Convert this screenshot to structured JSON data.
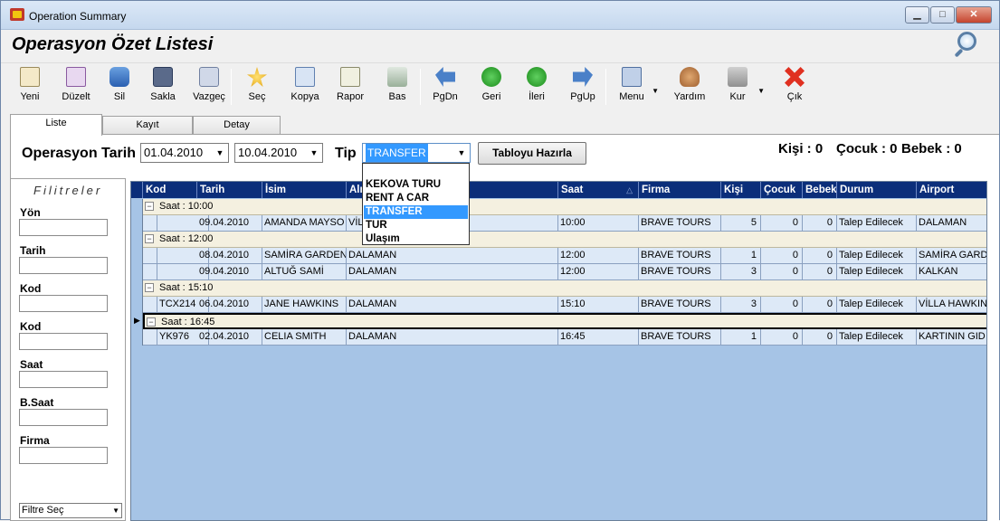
{
  "window": {
    "title": "Operation Summary",
    "minimize": "▁",
    "maximize": "□",
    "close": "✕"
  },
  "header": {
    "title": "Operasyon Özet Listesi"
  },
  "toolbar": [
    {
      "label": "Yeni",
      "icon": "new-document-icon"
    },
    {
      "label": "Düzelt",
      "icon": "edit-icon"
    },
    {
      "label": "Sil",
      "icon": "delete-database-icon"
    },
    {
      "label": "Sakla",
      "icon": "save-icon"
    },
    {
      "label": "Vazgeç",
      "icon": "cancel-icon"
    },
    {
      "label": "Seç",
      "icon": "select-star-icon"
    },
    {
      "label": "Kopya",
      "icon": "copy-icon"
    },
    {
      "label": "Rapor",
      "icon": "report-icon"
    },
    {
      "label": "Bas",
      "icon": "print-icon"
    },
    {
      "label": "PgDn",
      "icon": "page-down-icon"
    },
    {
      "label": "Geri",
      "icon": "back-icon"
    },
    {
      "label": "İleri",
      "icon": "forward-icon"
    },
    {
      "label": "PgUp",
      "icon": "page-up-icon"
    },
    {
      "label": "Menu",
      "icon": "menu-icon"
    },
    {
      "label": "Yardım",
      "icon": "help-icon"
    },
    {
      "label": "Kur",
      "icon": "tools-icon"
    },
    {
      "label": "Çık",
      "icon": "exit-icon"
    }
  ],
  "tabs": [
    "Liste",
    "Kayıt",
    "Detay"
  ],
  "options": {
    "date_label": "Operasyon Tarih",
    "date_from": "01.04.2010",
    "date_to": "10.04.2010",
    "tip_label": "Tip",
    "tip_value": "TRANSFER",
    "build_button": "Tabloyu Hazırla",
    "counts": {
      "kisi": "Kişi : 0",
      "cocuk": "Çocuk : 0",
      "bebek": "Bebek : 0"
    },
    "tip_options": [
      "KEKOVA TURU",
      "RENT A CAR",
      "TRANSFER",
      "TUR",
      "Ulaşım"
    ]
  },
  "filters": {
    "heading": "Filitreler",
    "fields": [
      "Yön",
      "Tarih",
      "Kod",
      "Kod",
      "Saat",
      "B.Saat",
      "Firma"
    ],
    "select_label": "Filtre Seç"
  },
  "grid": {
    "columns": [
      "Kod",
      "Tarih",
      "İsim",
      "Alış",
      "Saat",
      "Firma",
      "Kişi",
      "Çocuk",
      "Bebek",
      "Durum",
      "Airport"
    ],
    "sort_glyph": "△",
    "groups": [
      {
        "label": "Saat : 10:00",
        "rows": [
          [
            "",
            "09.04.2010",
            "AMANDA MAYSO",
            "VİLLA",
            "10:00",
            "BRAVE TOURS",
            "5",
            "0",
            "0",
            "Talep Edilecek",
            "DALAMAN"
          ]
        ]
      },
      {
        "label": "Saat : 12:00",
        "rows": [
          [
            "",
            "08.04.2010",
            "SAMİRA GARDEN",
            "DALAMAN",
            "12:00",
            "BRAVE TOURS",
            "1",
            "0",
            "0",
            "Talep Edilecek",
            "SAMİRA GARD"
          ],
          [
            "",
            "09.04.2010",
            "ALTUĞ SAMİ",
            "DALAMAN",
            "12:00",
            "BRAVE TOURS",
            "3",
            "0",
            "0",
            "Talep Edilecek",
            "KALKAN"
          ]
        ]
      },
      {
        "label": "Saat : 15:10",
        "rows": [
          [
            "TCX214",
            "06.04.2010",
            "JANE HAWKINS",
            "DALAMAN",
            "15:10",
            "BRAVE TOURS",
            "3",
            "0",
            "0",
            "Talep Edilecek",
            "VİLLA HAWKIN"
          ]
        ]
      },
      {
        "label": "Saat : 16:45",
        "rows": [
          [
            "YK976",
            "02.04.2010",
            "CELIA SMITH",
            "DALAMAN",
            "16:45",
            "BRAVE TOURS",
            "1",
            "0",
            "0",
            "Talep Edilecek",
            "KARTININ GID"
          ]
        ]
      }
    ]
  }
}
